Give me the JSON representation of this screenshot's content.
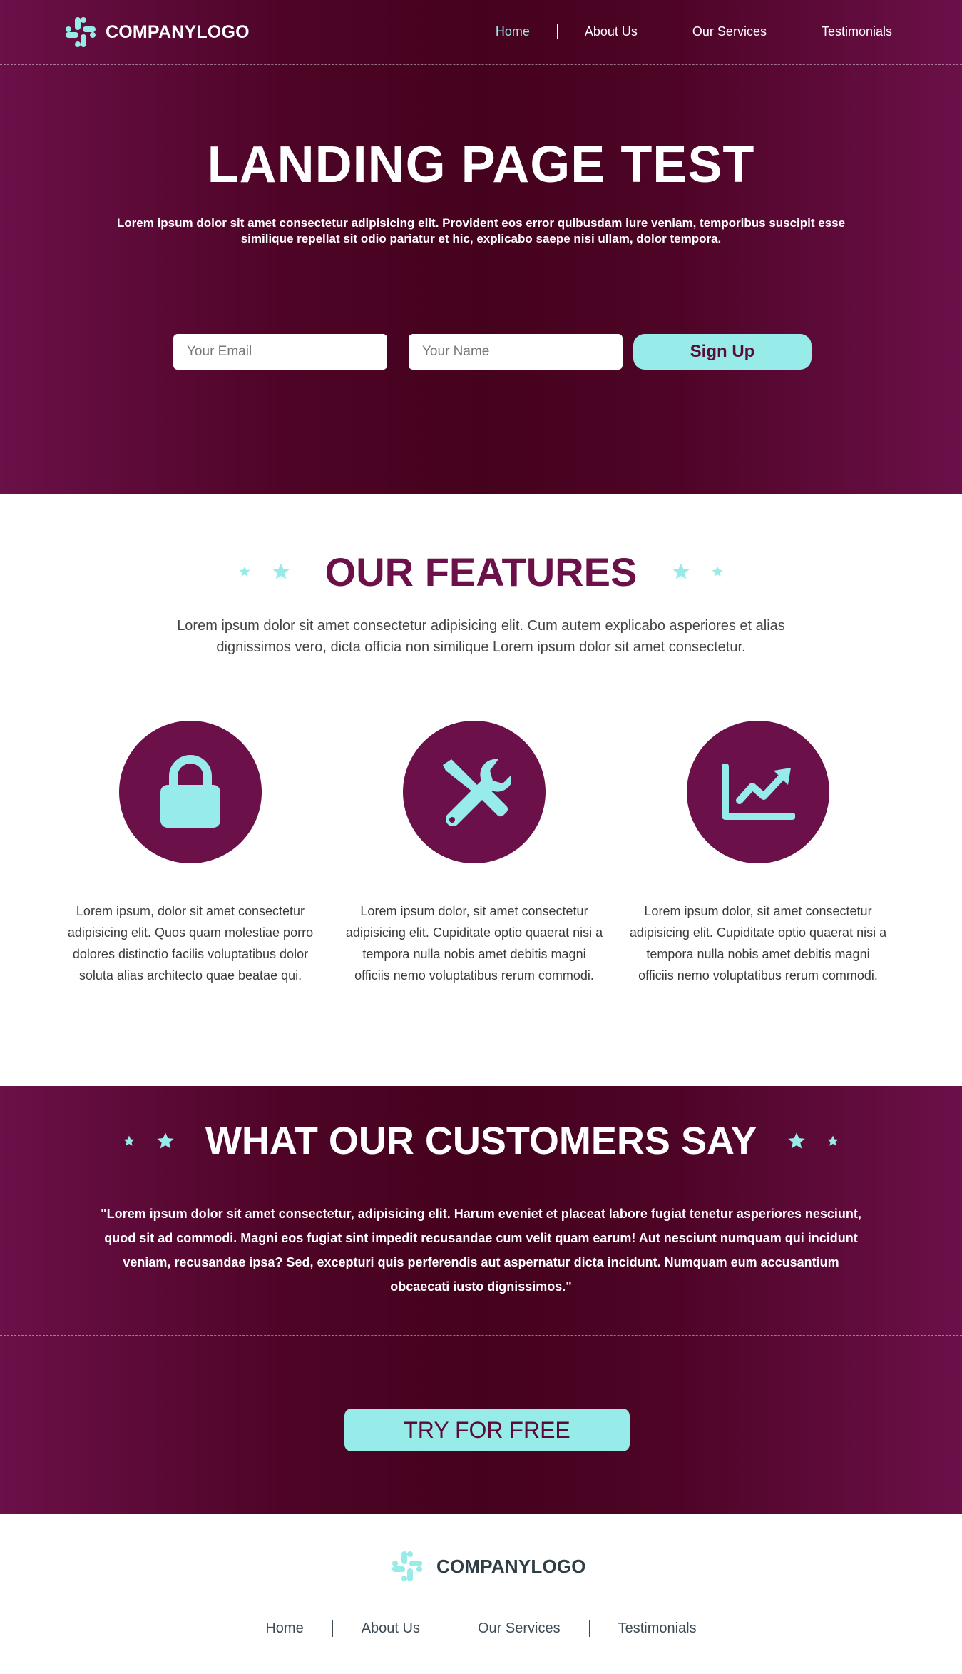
{
  "header": {
    "logo_text": "COMPANYLOGO",
    "nav": [
      "Home",
      "About Us",
      "Our Services",
      "Testimonials"
    ]
  },
  "hero": {
    "title": "LANDING PAGE TEST",
    "description": "Lorem ipsum dolor sit amet consectetur adipisicing elit. Provident eos error quibusdam iure veniam, temporibus suscipit esse similique repellat sit odio pariatur et hic, explicabo saepe nisi ullam, dolor tempora.",
    "email_placeholder": "Your Email",
    "name_placeholder": "Your Name",
    "signup_label": "Sign Up"
  },
  "features": {
    "title_light": "OUR",
    "title_bold": "FEATURES",
    "description": "Lorem ipsum dolor sit amet consectetur adipisicing elit. Cum autem explicabo asperiores et alias dignissimos vero, dicta officia non similique Lorem ipsum dolor sit amet consectetur.",
    "items": [
      {
        "icon": "lock-icon",
        "text": "Lorem ipsum, dolor sit amet consectetur adipisicing elit. Quos quam molestiae porro dolores distinctio facilis voluptatibus dolor soluta alias architecto quae beatae qui."
      },
      {
        "icon": "tools-icon",
        "text": "Lorem ipsum dolor, sit amet consectetur adipisicing elit. Cupiditate optio quaerat nisi a tempora nulla nobis amet debitis magni officiis nemo voluptatibus rerum commodi."
      },
      {
        "icon": "chart-line-icon",
        "text": "Lorem ipsum dolor, sit amet consectetur adipisicing elit. Cupiditate optio quaerat nisi a tempora nulla nobis amet debitis magni officiis nemo voluptatibus rerum commodi."
      }
    ]
  },
  "testimonial": {
    "title_pre": "WHAT",
    "title_bold": "OUR CUSTOMERS",
    "title_post": "SAY",
    "quote": "\"Lorem ipsum dolor sit amet consectetur, adipisicing elit. Harum eveniet et placeat labore fugiat tenetur asperiores nesciunt, quod sit ad commodi. Magni eos fugiat sint impedit recusandae cum velit quam earum! Aut nesciunt numquam qui incidunt veniam, recusandae ipsa? Sed, excepturi quis perferendis aut aspernatur dicta incidunt. Numquam eum accusantium obcaecati iusto dignissimos.\"",
    "cta_label": "TRY FOR FREE"
  },
  "footer": {
    "logo_text": "COMPANYLOGO",
    "nav": [
      "Home",
      "About Us",
      "Our Services",
      "Testimonials"
    ]
  },
  "colors": {
    "primary": "#6b1049",
    "dark": "#45021e",
    "accent": "#97ebe8",
    "text_gray": "#444444",
    "footer_text": "#2f3e46"
  }
}
